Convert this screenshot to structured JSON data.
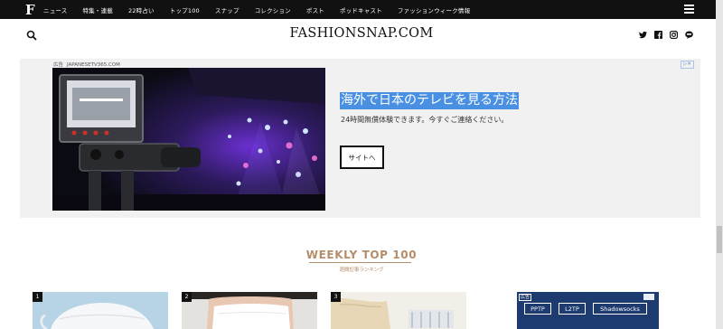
{
  "topnav": {
    "logo": "F",
    "items": [
      "ニュース",
      "特集・連載",
      "22時占い",
      "トップ100",
      "スナップ",
      "コレクション",
      "ポスト",
      "ポッドキャスト",
      "ファッションウィーク情報"
    ],
    "menu_icon": "hamburger-menu-icon"
  },
  "header": {
    "title": "FASHIONSNAP.COM",
    "search_icon": "search-icon",
    "social_icons": [
      "twitter-icon",
      "facebook-icon",
      "instagram-icon",
      "line-icon"
    ]
  },
  "ad": {
    "label": "広告",
    "domain": "JAPANESETV365.COM",
    "headline": "海外で日本のテレビを見る方法",
    "description": "24時間無償体験できます。今すぐご連絡ください。",
    "button": "サイトへ",
    "image": "tv-camera-concert-stage-photo"
  },
  "weekly": {
    "title": "WEEKLY TOP 100",
    "subtitle": "週間記事ランキング"
  },
  "ranking": {
    "items": [
      {
        "rank": "1",
        "image": "white-mask-photo"
      },
      {
        "rank": "2",
        "image": "person-wearing-white-mask-photo"
      },
      {
        "rank": "3",
        "image": "fabric-product-photo"
      }
    ]
  },
  "ad2": {
    "label": "広告",
    "chips": [
      "PPTP",
      "L2TP",
      "Shadowsocks"
    ]
  },
  "colors": {
    "nav_bg": "#111111",
    "accent_gold": "#b48d6a",
    "highlight": "#4a90e2"
  }
}
